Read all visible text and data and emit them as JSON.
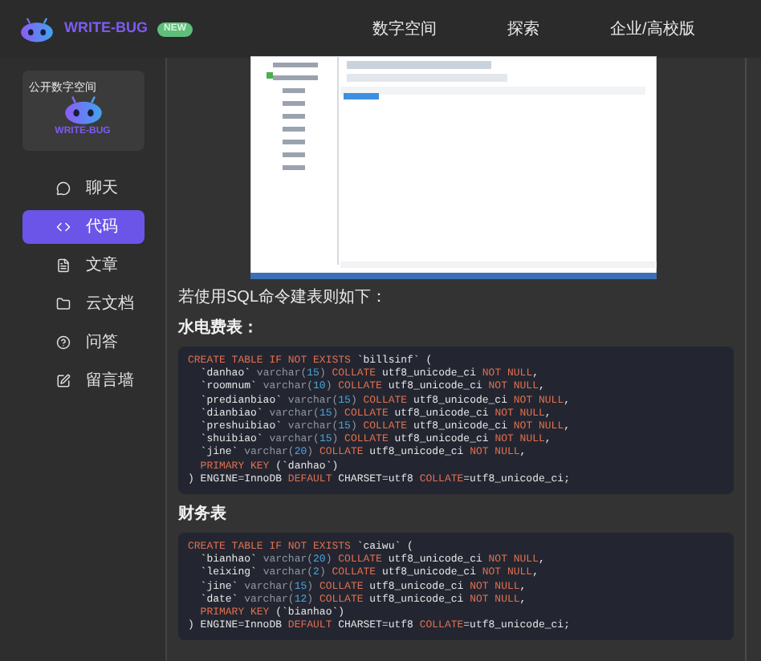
{
  "header": {
    "brand": "WRITE-BUG",
    "badge": "NEW",
    "nav": [
      "数字空间",
      "探索",
      "企业/高校版"
    ]
  },
  "sidebar": {
    "promo": {
      "tag": "公开数字空间",
      "brand": "WRITE-BUG"
    },
    "items": [
      {
        "label": "聊天",
        "selected": false
      },
      {
        "label": "代码",
        "selected": true
      },
      {
        "label": "文章",
        "selected": false
      },
      {
        "label": "云文档",
        "selected": false
      },
      {
        "label": "问答",
        "selected": false
      },
      {
        "label": "留言墙",
        "selected": false
      }
    ]
  },
  "article": [
    {
      "kind": "screenshot"
    },
    {
      "kind": "text",
      "text": "若使用SQL命令建表则如下："
    },
    {
      "kind": "heading",
      "text": "水电费表："
    },
    {
      "kind": "code",
      "lines": [
        [
          {
            "kind": "kw",
            "text": "CREATE TABLE IF NOT EXISTS"
          },
          {
            "kind": "id",
            "text": " `billsinf` ("
          }
        ],
        [
          {
            "kind": "id",
            "text": "  `danhao` "
          },
          {
            "kind": "ty",
            "text": "varchar("
          },
          {
            "kind": "num",
            "text": "15"
          },
          {
            "kind": "ty",
            "text": ")"
          },
          {
            "kind": "kw",
            "text": " COLLATE"
          },
          {
            "kind": "id",
            "text": " utf8_unicode_ci "
          },
          {
            "kind": "kw",
            "text": "NOT NULL"
          },
          {
            "kind": "id",
            "text": ","
          }
        ],
        [
          {
            "kind": "id",
            "text": "  `roomnum` "
          },
          {
            "kind": "ty",
            "text": "varchar("
          },
          {
            "kind": "num",
            "text": "10"
          },
          {
            "kind": "ty",
            "text": ")"
          },
          {
            "kind": "kw",
            "text": " COLLATE"
          },
          {
            "kind": "id",
            "text": " utf8_unicode_ci "
          },
          {
            "kind": "kw",
            "text": "NOT NULL"
          },
          {
            "kind": "id",
            "text": ","
          }
        ],
        [
          {
            "kind": "id",
            "text": "  `predianbiao` "
          },
          {
            "kind": "ty",
            "text": "varchar("
          },
          {
            "kind": "num",
            "text": "15"
          },
          {
            "kind": "ty",
            "text": ")"
          },
          {
            "kind": "kw",
            "text": " COLLATE"
          },
          {
            "kind": "id",
            "text": " utf8_unicode_ci "
          },
          {
            "kind": "kw",
            "text": "NOT NULL"
          },
          {
            "kind": "id",
            "text": ","
          }
        ],
        [
          {
            "kind": "id",
            "text": "  `dianbiao` "
          },
          {
            "kind": "ty",
            "text": "varchar("
          },
          {
            "kind": "num",
            "text": "15"
          },
          {
            "kind": "ty",
            "text": ")"
          },
          {
            "kind": "kw",
            "text": " COLLATE"
          },
          {
            "kind": "id",
            "text": " utf8_unicode_ci "
          },
          {
            "kind": "kw",
            "text": "NOT NULL"
          },
          {
            "kind": "id",
            "text": ","
          }
        ],
        [
          {
            "kind": "id",
            "text": "  `preshuibiao` "
          },
          {
            "kind": "ty",
            "text": "varchar("
          },
          {
            "kind": "num",
            "text": "15"
          },
          {
            "kind": "ty",
            "text": ")"
          },
          {
            "kind": "kw",
            "text": " COLLATE"
          },
          {
            "kind": "id",
            "text": " utf8_unicode_ci "
          },
          {
            "kind": "kw",
            "text": "NOT NULL"
          },
          {
            "kind": "id",
            "text": ","
          }
        ],
        [
          {
            "kind": "id",
            "text": "  `shuibiao` "
          },
          {
            "kind": "ty",
            "text": "varchar("
          },
          {
            "kind": "num",
            "text": "15"
          },
          {
            "kind": "ty",
            "text": ")"
          },
          {
            "kind": "kw",
            "text": " COLLATE"
          },
          {
            "kind": "id",
            "text": " utf8_unicode_ci "
          },
          {
            "kind": "kw",
            "text": "NOT NULL"
          },
          {
            "kind": "id",
            "text": ","
          }
        ],
        [
          {
            "kind": "id",
            "text": "  `jine` "
          },
          {
            "kind": "ty",
            "text": "varchar("
          },
          {
            "kind": "num",
            "text": "20"
          },
          {
            "kind": "ty",
            "text": ")"
          },
          {
            "kind": "kw",
            "text": " COLLATE"
          },
          {
            "kind": "id",
            "text": " utf8_unicode_ci "
          },
          {
            "kind": "kw",
            "text": "NOT NULL"
          },
          {
            "kind": "id",
            "text": ","
          }
        ],
        [
          {
            "kind": "kw",
            "text": "  PRIMARY KEY"
          },
          {
            "kind": "id",
            "text": " (`danhao`)"
          }
        ],
        [
          {
            "kind": "id",
            "text": ") ENGINE=InnoDB "
          },
          {
            "kind": "kw",
            "text": "DEFAULT"
          },
          {
            "kind": "id",
            "text": " CHARSET=utf8 "
          },
          {
            "kind": "kw",
            "text": "COLLATE"
          },
          {
            "kind": "id",
            "text": "=utf8_unicode_ci;"
          }
        ]
      ]
    },
    {
      "kind": "heading",
      "text": "财务表"
    },
    {
      "kind": "code",
      "lines": [
        [
          {
            "kind": "kw",
            "text": "CREATE TABLE IF NOT EXISTS"
          },
          {
            "kind": "id",
            "text": " `caiwu` ("
          }
        ],
        [
          {
            "kind": "id",
            "text": "  `bianhao` "
          },
          {
            "kind": "ty",
            "text": "varchar("
          },
          {
            "kind": "num",
            "text": "20"
          },
          {
            "kind": "ty",
            "text": ")"
          },
          {
            "kind": "kw",
            "text": " COLLATE"
          },
          {
            "kind": "id",
            "text": " utf8_unicode_ci "
          },
          {
            "kind": "kw",
            "text": "NOT NULL"
          },
          {
            "kind": "id",
            "text": ","
          }
        ],
        [
          {
            "kind": "id",
            "text": "  `leixing` "
          },
          {
            "kind": "ty",
            "text": "varchar("
          },
          {
            "kind": "num",
            "text": "2"
          },
          {
            "kind": "ty",
            "text": ")"
          },
          {
            "kind": "kw",
            "text": " COLLATE"
          },
          {
            "kind": "id",
            "text": " utf8_unicode_ci "
          },
          {
            "kind": "kw",
            "text": "NOT NULL"
          },
          {
            "kind": "id",
            "text": ","
          }
        ],
        [
          {
            "kind": "id",
            "text": "  `jine` "
          },
          {
            "kind": "ty",
            "text": "varchar("
          },
          {
            "kind": "num",
            "text": "15"
          },
          {
            "kind": "ty",
            "text": ")"
          },
          {
            "kind": "kw",
            "text": " COLLATE"
          },
          {
            "kind": "id",
            "text": " utf8_unicode_ci "
          },
          {
            "kind": "kw",
            "text": "NOT NULL"
          },
          {
            "kind": "id",
            "text": ","
          }
        ],
        [
          {
            "kind": "id",
            "text": "  `date` "
          },
          {
            "kind": "ty",
            "text": "varchar("
          },
          {
            "kind": "num",
            "text": "12"
          },
          {
            "kind": "ty",
            "text": ")"
          },
          {
            "kind": "kw",
            "text": " COLLATE"
          },
          {
            "kind": "id",
            "text": " utf8_unicode_ci "
          },
          {
            "kind": "kw",
            "text": "NOT NULL"
          },
          {
            "kind": "id",
            "text": ","
          }
        ],
        [
          {
            "kind": "kw",
            "text": "  PRIMARY KEY"
          },
          {
            "kind": "id",
            "text": " (`bianhao`)"
          }
        ],
        [
          {
            "kind": "id",
            "text": ") ENGINE=InnoDB "
          },
          {
            "kind": "kw",
            "text": "DEFAULT"
          },
          {
            "kind": "id",
            "text": " CHARSET=utf8 "
          },
          {
            "kind": "kw",
            "text": "COLLATE"
          },
          {
            "kind": "id",
            "text": "=utf8_unicode_ci;"
          }
        ]
      ]
    }
  ]
}
